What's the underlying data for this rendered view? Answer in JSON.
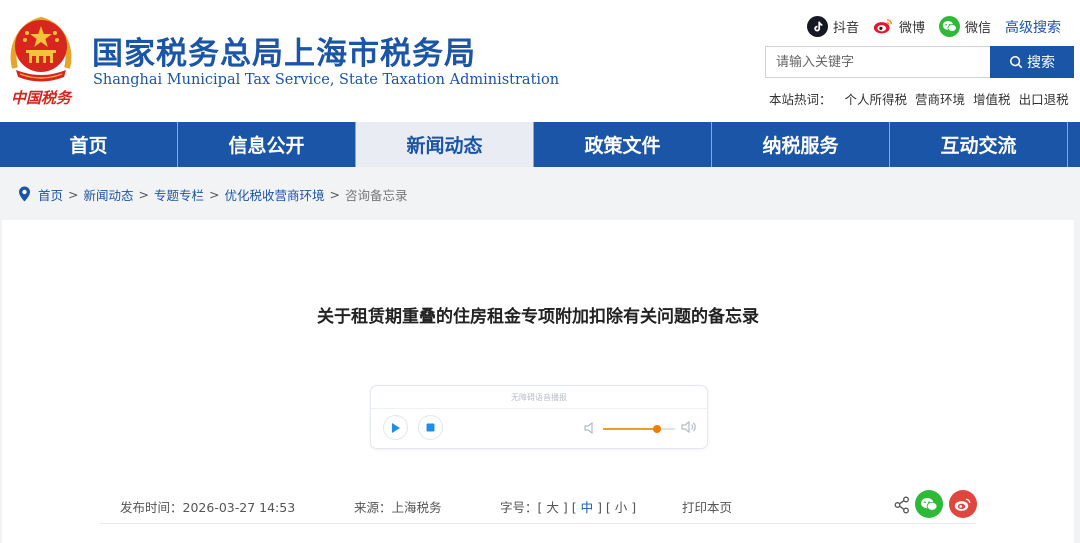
{
  "header": {
    "title": "国家税务总局上海市税务局",
    "subtitle": "Shanghai Municipal Tax Service, State Taxation Administration",
    "logo_text": "中国税务",
    "social": [
      {
        "label": "抖音",
        "icon": "douyin-icon"
      },
      {
        "label": "微博",
        "icon": "weibo-icon"
      },
      {
        "label": "微信",
        "icon": "wechat-icon"
      }
    ],
    "advanced_search": "高级搜索",
    "search": {
      "placeholder": "请输入关键字",
      "value": "",
      "button": "搜索"
    },
    "hot": {
      "label": "本站热词：",
      "items": [
        "个人所得税",
        "营商环境",
        "增值税",
        "出口退税"
      ]
    }
  },
  "nav": {
    "items": [
      {
        "label": "首页"
      },
      {
        "label": "信息公开"
      },
      {
        "label": "新闻动态",
        "active": true
      },
      {
        "label": "政策文件"
      },
      {
        "label": "纳税服务"
      },
      {
        "label": "互动交流"
      }
    ]
  },
  "breadcrumb": {
    "items": [
      "首页",
      "新闻动态",
      "专题专栏",
      "优化税收营商环境"
    ],
    "separator": ">",
    "current": "咨询备忘录"
  },
  "article": {
    "title": "关于租赁期重叠的住房租金专项附加扣除有关问题的备忘录",
    "player": {
      "label": "无障碍语音播报",
      "volume": 0.75
    },
    "meta": {
      "date_label": "发布时间：",
      "date": "2026-03-27 14:53",
      "source_label": "来源：",
      "source": "上海税务",
      "font_label": "字号：",
      "font_sizes": [
        "大",
        "中",
        "小"
      ],
      "font_active": "中",
      "print": "打印本页"
    }
  },
  "colors": {
    "brand_blue": "#1b55a8",
    "nav_active_bg": "#e9edf3",
    "emblem_red": "#d7261e",
    "emblem_gold": "#f3c33a",
    "volume_orange": "#f07c00",
    "wechat_green": "#2dbb37",
    "weibo_red": "#e0463d"
  }
}
